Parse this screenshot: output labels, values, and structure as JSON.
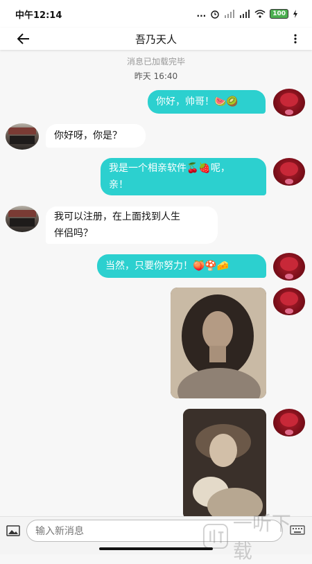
{
  "status_bar": {
    "time": "中午12:14",
    "dots": "...",
    "battery": "100"
  },
  "header": {
    "title": "吾乃天人"
  },
  "chat": {
    "loaded_notice": "消息已加载完毕",
    "timestamp": "昨天 16:40",
    "messages": [
      {
        "from": "me",
        "text": "你好，帅哥！",
        "emoji": "🍉🥝"
      },
      {
        "from": "other",
        "text": "你好呀，你是？"
      },
      {
        "from": "me",
        "text_line1": "我是一个相亲软件",
        "emoji": "🍒🍓",
        "text_line1_end": "呢，",
        "text_line2": "亲！"
      },
      {
        "from": "other",
        "text_line1": "我可以注册，在上面找到人生",
        "text_line2": "伴侣吗？"
      },
      {
        "from": "me",
        "text": "当然，只要你努力！",
        "emoji": "🍑🍄🧀"
      }
    ]
  },
  "input": {
    "placeholder": "输入新消息"
  },
  "watermark": {
    "text": "一听下载"
  },
  "colors": {
    "my_bubble": "#2cd0cf",
    "other_bubble": "#ffffff",
    "background": "#f7f7f7"
  }
}
